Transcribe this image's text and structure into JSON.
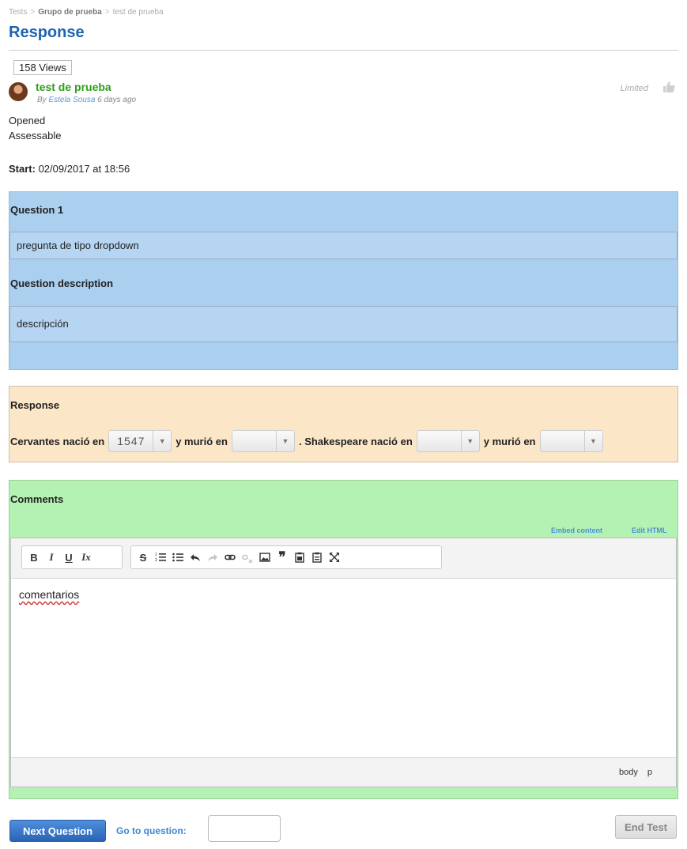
{
  "breadcrumb": {
    "items": [
      "Tests",
      "Grupo de prueba",
      "test de prueba"
    ],
    "separator": ">"
  },
  "page_title": "Response",
  "views": "158 Views",
  "post": {
    "title": "test de prueba",
    "by_prefix": "By",
    "author": "Estela Sousa",
    "time_ago": "6 days ago",
    "limited": "Limited"
  },
  "status": {
    "opened": "Opened",
    "assessable": "Assessable"
  },
  "start": {
    "label": "Start:",
    "value": "02/09/2017 at 18:56"
  },
  "question": {
    "heading": "Question 1",
    "text": "pregunta de tipo dropdown",
    "description_heading": "Question description",
    "description": "descripción"
  },
  "response": {
    "heading": "Response",
    "segments": [
      "Cervantes nació en",
      "y murió en",
      ". Shakespeare nació en",
      "y murió en"
    ],
    "selects": [
      {
        "selected": "1547"
      },
      {
        "selected": ""
      },
      {
        "selected": ""
      },
      {
        "selected": ""
      }
    ]
  },
  "comments": {
    "heading": "Comments",
    "embed_link": "Embed content",
    "edit_html_link": "Edit HTML",
    "toolbar_group1": [
      "B",
      "I",
      "U",
      "Ix"
    ],
    "editor_text": "comentarios",
    "path": [
      "body",
      "p"
    ]
  },
  "footer": {
    "next_label": "Next Question",
    "goto_label": "Go to question:",
    "goto_value": "",
    "end_label": "End Test"
  },
  "colors": {
    "title_blue": "#1d64b1",
    "question_bg": "#aacfef",
    "response_bg": "#fbe7c7",
    "comments_bg": "#b4f2b4",
    "post_title_green": "#2e9e1a"
  }
}
